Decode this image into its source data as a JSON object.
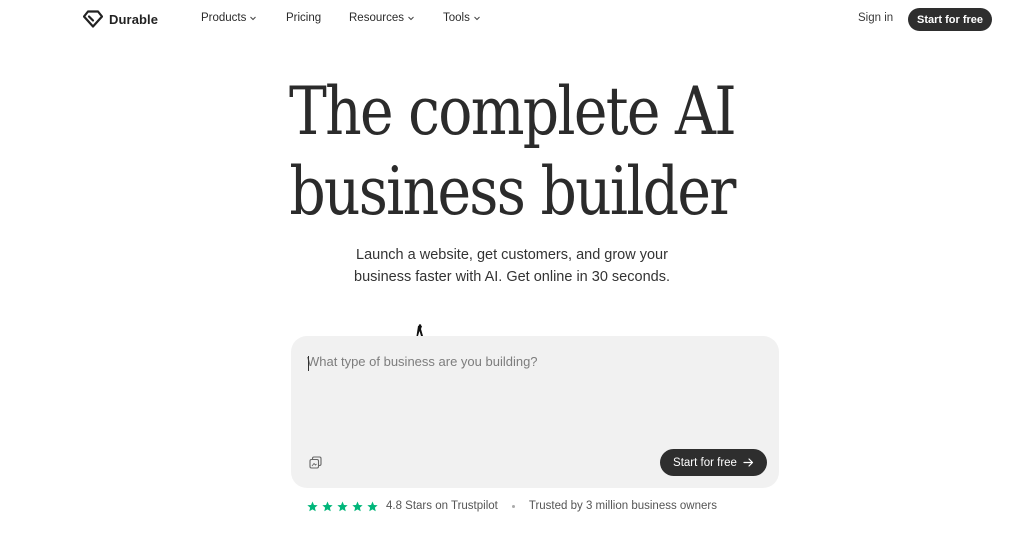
{
  "nav": {
    "brand": "Durable",
    "items": [
      {
        "label": "Products",
        "has_dropdown": true
      },
      {
        "label": "Pricing",
        "has_dropdown": false
      },
      {
        "label": "Resources",
        "has_dropdown": true
      },
      {
        "label": "Tools",
        "has_dropdown": true
      }
    ],
    "signin_label": "Sign in",
    "cta_label": "Start for free"
  },
  "hero": {
    "headline_line1": "The complete AI",
    "headline_line2": "business builder",
    "sub_line1": "Launch a website, get customers, and grow your",
    "sub_line2": "business faster with AI. Get online in 30 seconds."
  },
  "prompt": {
    "placeholder": "What type of business are you building?",
    "value": "",
    "attach_icon": "attach-icon",
    "cta_label": "Start for free",
    "cta_icon": "arrow-right-icon"
  },
  "trust": {
    "stars_count": 5,
    "rating_text": "4.8 Stars on Trustpilot",
    "trusted_text": "Trusted by 3 million business owners"
  },
  "colors": {
    "primary_dark": "#2e2e2e",
    "star_green": "#00b67a",
    "input_bg": "#f1f1f1"
  }
}
